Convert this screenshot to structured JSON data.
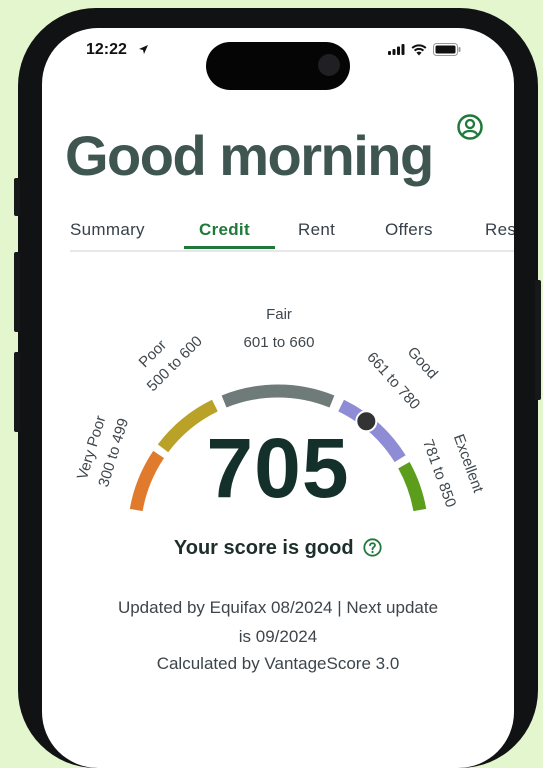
{
  "status_bar": {
    "time": "12:22"
  },
  "header": {
    "greeting": "Good morning"
  },
  "tabs": [
    {
      "label": "Summary",
      "active": false
    },
    {
      "label": "Credit",
      "active": true
    },
    {
      "label": "Rent",
      "active": false
    },
    {
      "label": "Offers",
      "active": false
    },
    {
      "label": "Res",
      "active": false
    }
  ],
  "gauge": {
    "min": 300,
    "max": 850,
    "bands": [
      {
        "name": "Very Poor",
        "range": "300 to 499",
        "color": "#e07a2c"
      },
      {
        "name": "Poor",
        "range": "500 to 600",
        "color": "#b9a227"
      },
      {
        "name": "Fair",
        "range": "601 to 660",
        "color": "#6f7b79"
      },
      {
        "name": "Good",
        "range": "661 to 780",
        "color": "#8f8cd6"
      },
      {
        "name": "Excellent",
        "range": "781 to 850",
        "color": "#5c9d1c"
      }
    ],
    "score": "705"
  },
  "verdict": "Your score is good",
  "update": {
    "line1": "Updated by Equifax 08/2024 | Next update",
    "line2": "is 09/2024",
    "line3": "Calculated by VantageScore 3.0"
  },
  "colors": {
    "brand_green": "#1f7a3a",
    "background": "#e3f6cd",
    "heading": "#3f5550"
  }
}
